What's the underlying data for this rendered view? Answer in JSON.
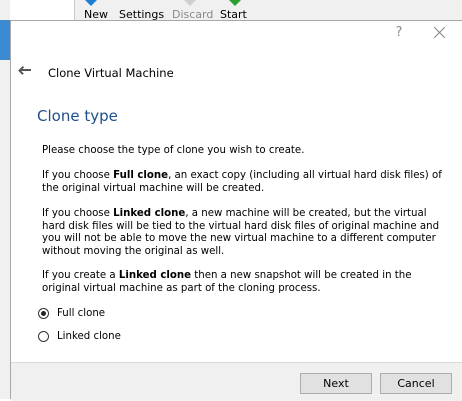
{
  "toolbar": {
    "items": [
      {
        "label": "New",
        "icon": "new-icon"
      },
      {
        "label": "Settings",
        "icon": "settings-icon"
      },
      {
        "label": "Discard",
        "icon": "discard-icon"
      },
      {
        "label": "Start",
        "icon": "start-icon"
      }
    ]
  },
  "dialog": {
    "help_label": "?",
    "title": "Clone Virtual Machine",
    "section_title": "Clone type",
    "paragraphs": {
      "p1": "Please choose the type of clone you wish to create.",
      "p2_pre": "If you choose ",
      "p2_bold": "Full clone",
      "p2_post": ", an exact copy (including all virtual hard disk files) of the original virtual machine will be created.",
      "p3_pre": "If you choose ",
      "p3_bold": "Linked clone",
      "p3_post": ", a new machine will be created, but the virtual hard disk files will be tied to the virtual hard disk files of original machine and you will not be able to move the new virtual machine to a different computer without moving the original as well.",
      "p4_pre": "If you create a ",
      "p4_bold": "Linked clone",
      "p4_post": " then a new snapshot will be created in the original virtual machine as part of the cloning process."
    },
    "options": [
      {
        "label": "Full clone",
        "selected": true
      },
      {
        "label": "Linked clone",
        "selected": false
      }
    ],
    "buttons": {
      "next": "Next",
      "cancel": "Cancel"
    }
  },
  "colors": {
    "section_title": "#1e4f8c",
    "footer_bg": "#f0f0f0",
    "button_bg": "#e1e1e1"
  }
}
